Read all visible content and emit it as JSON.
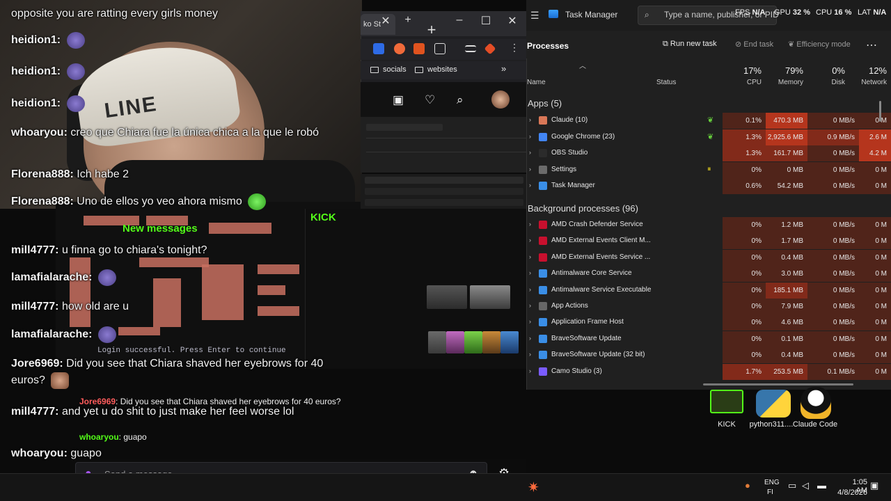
{
  "chat": {
    "messages": [
      {
        "user": "",
        "text": "opposite you are ratting every girls money"
      },
      {
        "user": "heidion1:",
        "text": ""
      },
      {
        "user": "heidion1:",
        "text": ""
      },
      {
        "user": "heidion1:",
        "text": ""
      },
      {
        "user": "whoaryou:",
        "text": "creo que Chiara fue la única chica a la que le robó"
      },
      {
        "user": "Florena888:",
        "text": "Ich habe 2"
      },
      {
        "user": "Florena888:",
        "text": "Uno de ellos yo veo ahora mismo"
      },
      {
        "user": "mill4777:",
        "text": "u finna go to chiara's tonight?"
      },
      {
        "user": "lamafialarache:",
        "text": ""
      },
      {
        "user": "mill4777:",
        "text": "how old are u"
      },
      {
        "user": "lamafialarache:",
        "text": ""
      },
      {
        "user": "Jore6969:",
        "text": "Did you see that Chiara shaved her eyebrows for 40 euros?"
      },
      {
        "user": "mill4777:",
        "text": "and yet u do shit to just make her feel worse lol"
      },
      {
        "user": "whoaryou:",
        "text": "guapo"
      }
    ],
    "beanie_text": "LINE",
    "new_messages": "New messages",
    "inner_messages": [
      {
        "user": "Jore6969",
        "text": ": Did you see that Chiara shaved her eyebrows for 40 euros?"
      },
      {
        "user": "mill4777",
        "text": ": and yet u do shit to just make her feel worse lol"
      },
      {
        "user": "whoaryou",
        "text": ": guapo"
      }
    ],
    "login_text": "Login successful. Press Enter to continue",
    "input_placeholder": "Send a message"
  },
  "browser": {
    "tab_label": "ko St",
    "bookmarks": [
      "socials",
      "websites"
    ],
    "kick_label": "KICK"
  },
  "task_manager": {
    "title": "Task Manager",
    "search_placeholder": "Type a name, publisher, or PID",
    "perf": [
      {
        "label": "FPS",
        "value": "N/A"
      },
      {
        "label": "GPU",
        "value": "32 %"
      },
      {
        "label": "CPU",
        "value": "16 %"
      },
      {
        "label": "LAT",
        "value": "N/A"
      }
    ],
    "heading": "Processes",
    "toolbar": {
      "run": "Run new task",
      "end": "End task",
      "efficiency": "Efficiency mode"
    },
    "columns": {
      "name": "Name",
      "status": "Status",
      "cpu_pct": "17%",
      "cpu": "CPU",
      "mem_pct": "79%",
      "mem": "Memory",
      "disk_pct": "0%",
      "disk": "Disk",
      "net_pct": "12%",
      "net": "Network"
    },
    "apps_header": "Apps (5)",
    "apps": [
      {
        "name": "Claude (10)",
        "status": "leaf",
        "cpu": "0.1%",
        "mem": "470.3 MB",
        "disk": "0 MB/s",
        "net": "0 M"
      },
      {
        "name": "Google Chrome (23)",
        "status": "leaf",
        "cpu": "1.3%",
        "mem": "2,925.6 MB",
        "disk": "0.9 MB/s",
        "net": "2.6 M"
      },
      {
        "name": "OBS Studio",
        "status": "",
        "cpu": "1.3%",
        "mem": "161.7 MB",
        "disk": "0 MB/s",
        "net": "4.2 M"
      },
      {
        "name": "Settings",
        "status": "pause",
        "cpu": "0%",
        "mem": "0 MB",
        "disk": "0 MB/s",
        "net": "0 M"
      },
      {
        "name": "Task Manager",
        "status": "",
        "cpu": "0.6%",
        "mem": "54.2 MB",
        "disk": "0 MB/s",
        "net": "0 M"
      }
    ],
    "bg_header": "Background processes (96)",
    "background": [
      {
        "name": "AMD Crash Defender Service",
        "cpu": "0%",
        "mem": "1.2 MB",
        "disk": "0 MB/s",
        "net": "0 M"
      },
      {
        "name": "AMD External Events Client M...",
        "cpu": "0%",
        "mem": "1.7 MB",
        "disk": "0 MB/s",
        "net": "0 M"
      },
      {
        "name": "AMD External Events Service ...",
        "cpu": "0%",
        "mem": "0.4 MB",
        "disk": "0 MB/s",
        "net": "0 M"
      },
      {
        "name": "Antimalware Core Service",
        "cpu": "0%",
        "mem": "3.0 MB",
        "disk": "0 MB/s",
        "net": "0 M"
      },
      {
        "name": "Antimalware Service Executable",
        "cpu": "0%",
        "mem": "185.1 MB",
        "disk": "0 MB/s",
        "net": "0 M"
      },
      {
        "name": "App Actions",
        "cpu": "0%",
        "mem": "7.9 MB",
        "disk": "0 MB/s",
        "net": "0 M"
      },
      {
        "name": "Application Frame Host",
        "cpu": "0%",
        "mem": "4.6 MB",
        "disk": "0 MB/s",
        "net": "0 M"
      },
      {
        "name": "BraveSoftware Update",
        "cpu": "0%",
        "mem": "0.1 MB",
        "disk": "0 MB/s",
        "net": "0 M"
      },
      {
        "name": "BraveSoftware Update (32 bit)",
        "cpu": "0%",
        "mem": "0.4 MB",
        "disk": "0 MB/s",
        "net": "0 M"
      },
      {
        "name": "Camo Studio (3)",
        "cpu": "1.7%",
        "mem": "253.5 MB",
        "disk": "0.1 MB/s",
        "net": "0 M"
      }
    ]
  },
  "desktop": {
    "icons": [
      "KICK",
      "python311....",
      "Claude Code"
    ]
  },
  "taskbar": {
    "lang1": "ENG",
    "lang2": "FI",
    "time": "1:05 AM",
    "date": "4/8/2026"
  },
  "colors": {
    "kick_green": "#53fc18",
    "mic_purple": "#a855f7",
    "heat_high": "#be371e"
  }
}
